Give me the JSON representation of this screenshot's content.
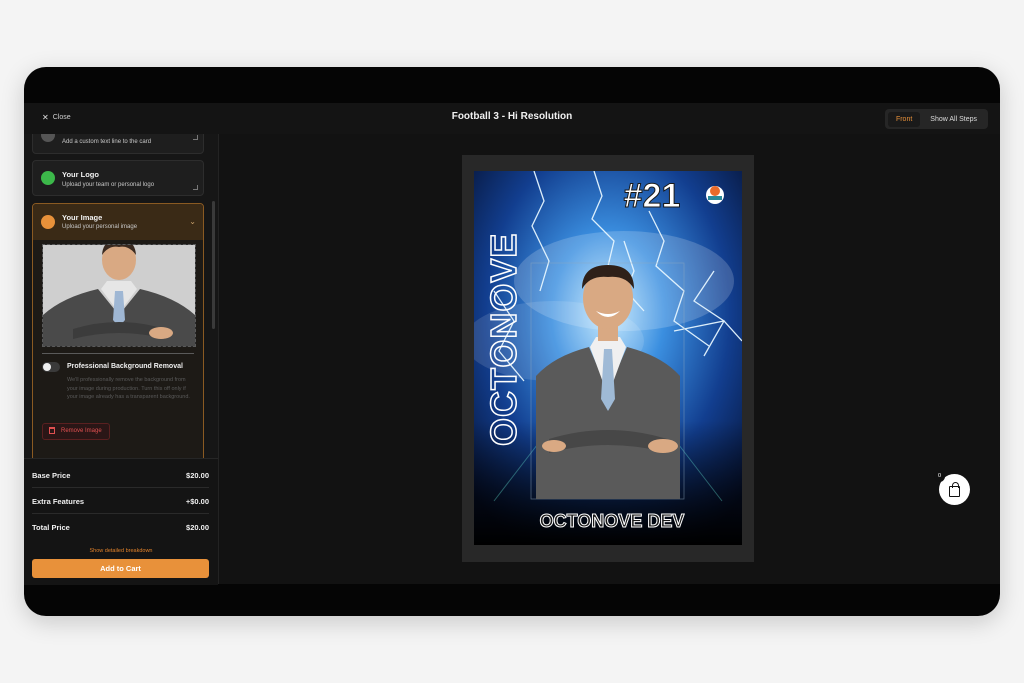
{
  "header": {
    "close_label": "Close",
    "title": "Football 3 - Hi Resolution",
    "view_toggle": {
      "front_label": "Front",
      "all_steps_label": "Show All Steps",
      "active": "front"
    }
  },
  "steps": {
    "custom_text": {
      "subtitle": "Add a custom text line to the card"
    },
    "logo": {
      "title": "Your Logo",
      "subtitle": "Upload your team or personal logo",
      "color": "#3cb84a"
    },
    "image": {
      "title": "Your Image",
      "subtitle": "Upload your personal image",
      "color": "#e8913a",
      "bg_removal_label": "Professional Background Removal",
      "bg_removal_enabled": false,
      "bg_removal_help": "We'll professionally remove the background from your image during production. Turn this off only if your image already has a transparent background.",
      "remove_label": "Remove Image"
    }
  },
  "pricing": {
    "base_label": "Base Price",
    "base_value": "$20.00",
    "extra_label": "Extra Features",
    "extra_value": "+$0.00",
    "total_label": "Total Price",
    "total_value": "$20.00",
    "breakdown_link": "Show detailed breakdown",
    "add_to_cart": "Add to Cart"
  },
  "card": {
    "number": "#21",
    "vertical_name": "OCTONOVE",
    "bottom_name": "OCTONOVE DEV"
  },
  "cart": {
    "count": "0"
  },
  "colors": {
    "accent": "#e8913a",
    "danger": "#e05050",
    "background": "#121212"
  }
}
